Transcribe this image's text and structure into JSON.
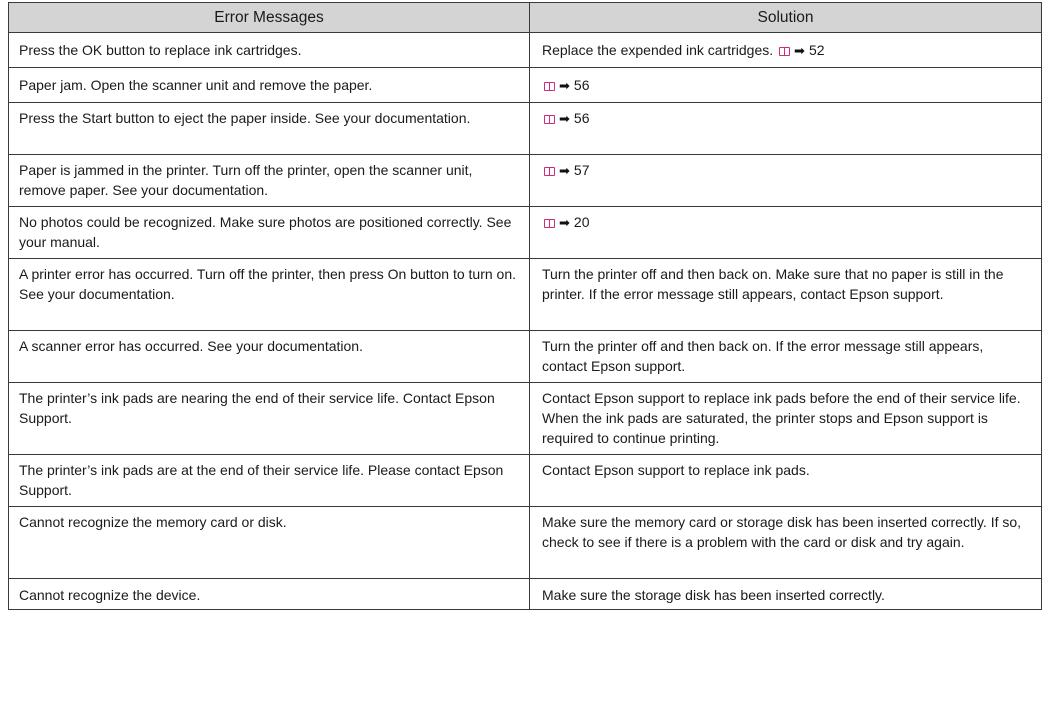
{
  "table": {
    "headers": {
      "messages": "Error Messages",
      "solution": "Solution"
    },
    "rows": [
      {
        "message": "Press the OK button to replace ink cartridges.",
        "solution_text": "Replace the expended ink cartridges.",
        "page_ref": "52"
      },
      {
        "message": "Paper jam. Open the scanner unit and remove the paper.",
        "solution_text": "",
        "page_ref": "56"
      },
      {
        "message": "Press the Start button to eject the paper inside. See your documentation.",
        "solution_text": "",
        "page_ref": "56"
      },
      {
        "message": "Paper is jammed in the printer. Turn off the printer, open the scanner unit, remove paper. See your documentation.",
        "solution_text": "",
        "page_ref": "57"
      },
      {
        "message": "No photos could be recognized. Make sure photos are positioned correctly. See your manual.",
        "solution_text": "",
        "page_ref": "20"
      },
      {
        "message": "A printer error has occurred. Turn off the printer, then press On button to turn on. See your documentation.",
        "solution_text": "Turn the printer off and then back on. Make sure that no paper is still in the printer. If the error message still appears, contact Epson support.",
        "page_ref": ""
      },
      {
        "message": "A scanner error has occurred. See your documentation.",
        "solution_text": "Turn the printer off and then back on. If the error message still appears, contact Epson support.",
        "page_ref": ""
      },
      {
        "message": "The printer’s ink pads are nearing the end of their service life. Contact Epson Support.",
        "solution_text": "Contact Epson support to replace ink pads before the end of their service life. When the ink pads are saturated, the printer stops and Epson support is required to continue printing.",
        "page_ref": ""
      },
      {
        "message": "The printer’s ink pads are at the end of their service life. Please contact Epson Support.",
        "solution_text": "Contact Epson support to replace ink pads.",
        "page_ref": ""
      },
      {
        "message": "Cannot recognize the memory card or disk.",
        "solution_text": "Make sure the memory card or storage disk has been inserted correctly. If so, check to see if there is a problem with the card or disk and try again.",
        "page_ref": ""
      },
      {
        "message": "Cannot recognize the device.",
        "solution_text": "Make sure the storage disk has been inserted correctly.",
        "page_ref": ""
      }
    ]
  },
  "icons": {
    "reference": "book-icon",
    "arrow": "right-arrow-icon",
    "reference_color": "#d02a7a"
  },
  "colors": {
    "header_background": "#d4d4d4",
    "border": "#3a3a3a"
  }
}
